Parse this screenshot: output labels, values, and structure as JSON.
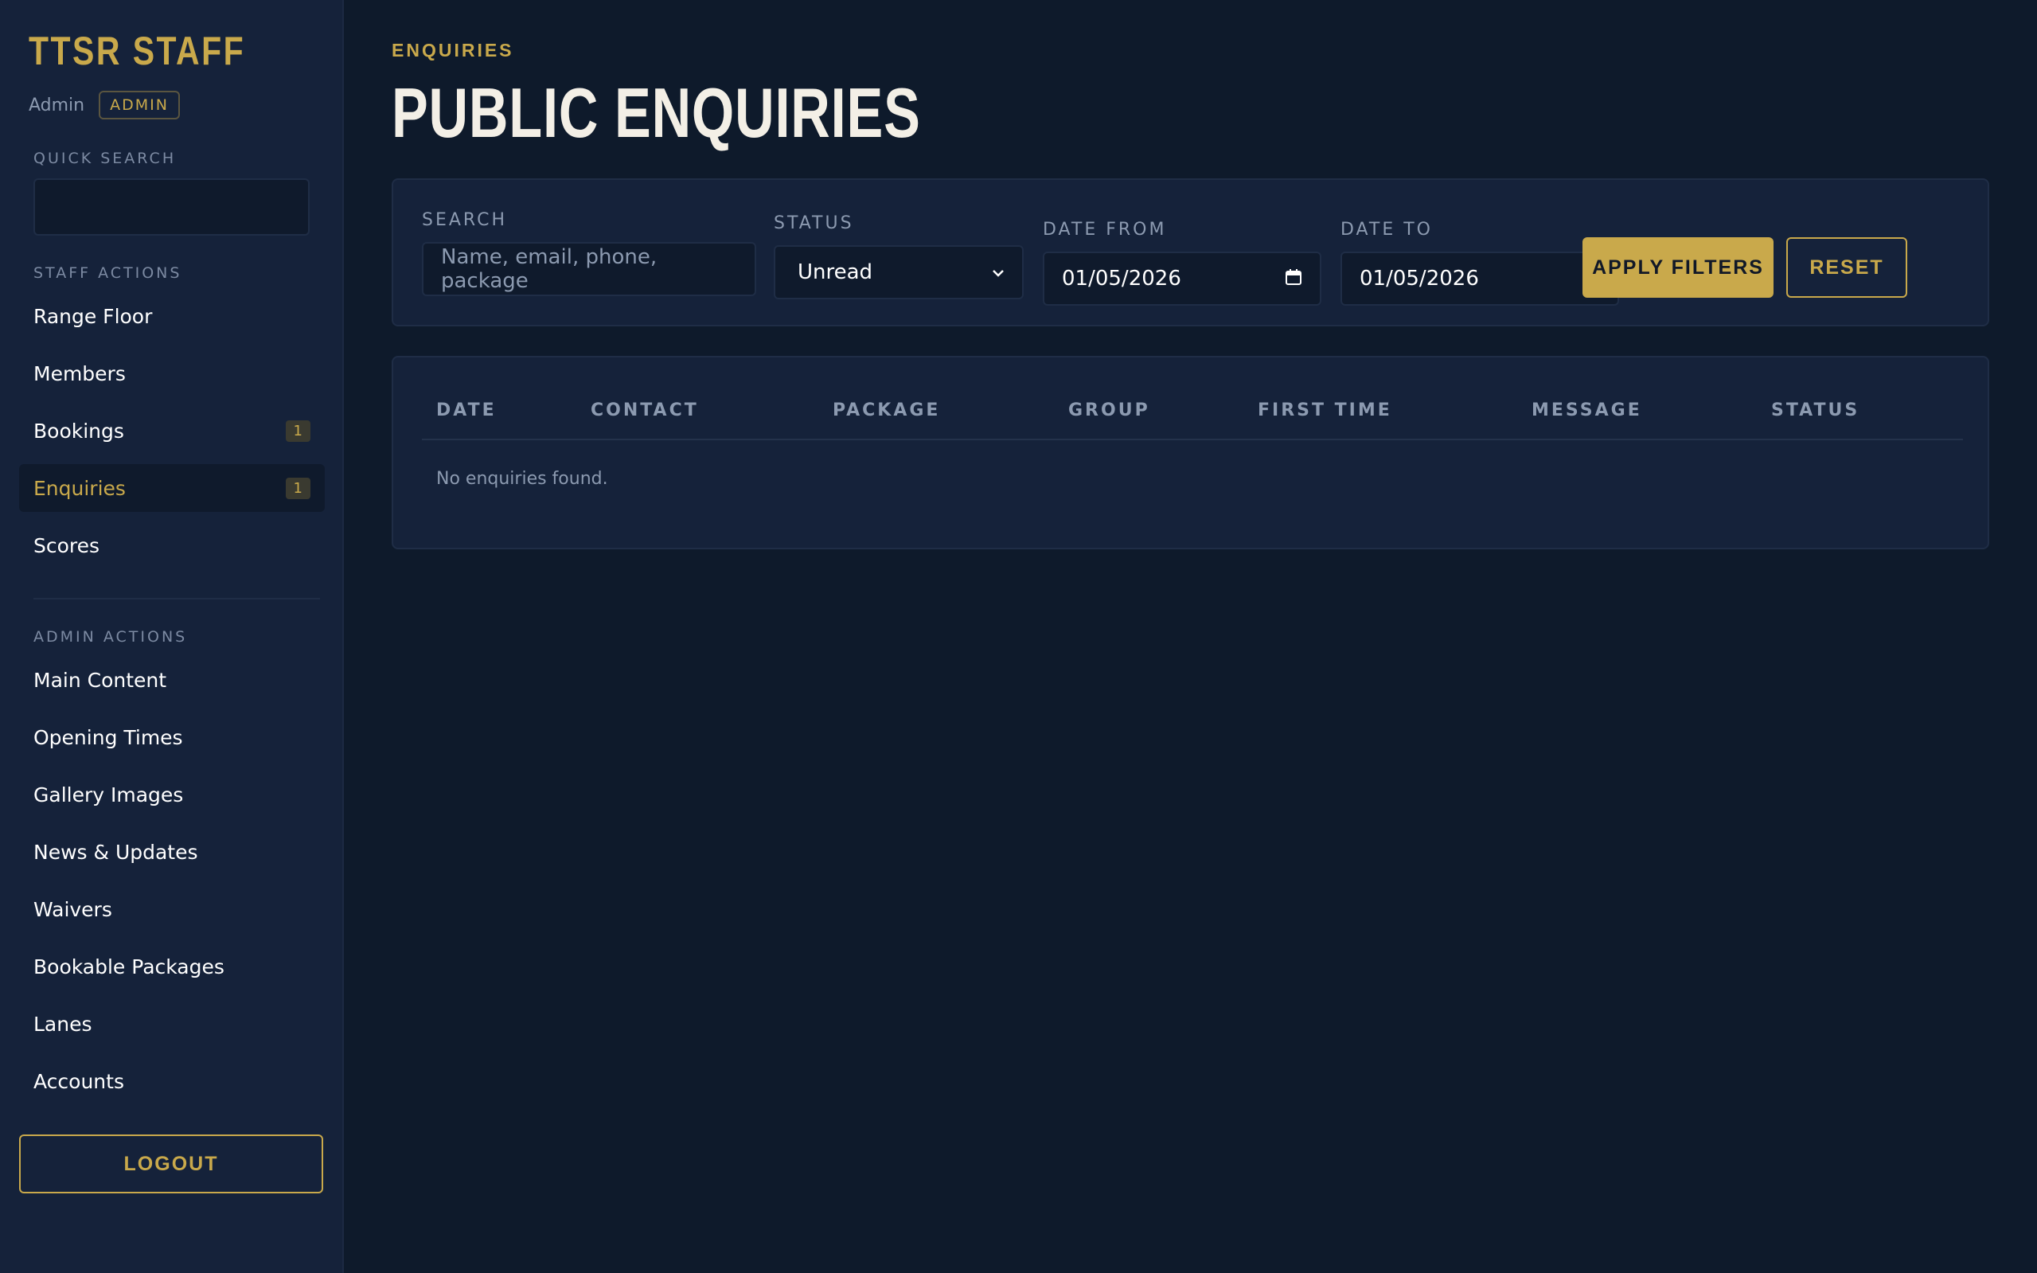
{
  "sidebar": {
    "brand": "TTSR STAFF",
    "user_name": "Admin",
    "role": "ADMIN",
    "quick_search_label": "QUICK SEARCH",
    "quick_search_value": "",
    "staff_actions_label": "STAFF ACTIONS",
    "staff_items": [
      {
        "label": "Range Floor",
        "badge": ""
      },
      {
        "label": "Members",
        "badge": ""
      },
      {
        "label": "Bookings",
        "badge": "1"
      },
      {
        "label": "Enquiries",
        "badge": "1"
      },
      {
        "label": "Scores",
        "badge": ""
      }
    ],
    "admin_actions_label": "ADMIN ACTIONS",
    "admin_items": [
      {
        "label": "Main Content"
      },
      {
        "label": "Opening Times"
      },
      {
        "label": "Gallery Images"
      },
      {
        "label": "News & Updates"
      },
      {
        "label": "Waivers"
      },
      {
        "label": "Bookable Packages"
      },
      {
        "label": "Lanes"
      },
      {
        "label": "Accounts"
      }
    ],
    "logout_label": "LOGOUT"
  },
  "header": {
    "eyebrow": "ENQUIRIES",
    "title": "PUBLIC ENQUIRIES"
  },
  "filters": {
    "search_label": "SEARCH",
    "search_placeholder": "Name, email, phone, package",
    "status_label": "STATUS",
    "status_value": "Unread",
    "date_from_label": "DATE FROM",
    "date_from_value": "01/05/2026",
    "date_to_label": "DATE TO",
    "date_to_value": "01/05/2026",
    "apply_label": "APPLY FILTERS",
    "reset_label": "RESET"
  },
  "table": {
    "columns": [
      "DATE",
      "CONTACT",
      "PACKAGE",
      "GROUP",
      "FIRST TIME",
      "MESSAGE",
      "STATUS"
    ],
    "empty_message": "No enquiries found."
  },
  "icons": {
    "status_dropdown": "chevron-down-icon",
    "date_picker": "calendar-icon"
  },
  "colors": {
    "accent": "#c9a94b",
    "background": "#0e1a2b",
    "panel": "#15223a"
  }
}
